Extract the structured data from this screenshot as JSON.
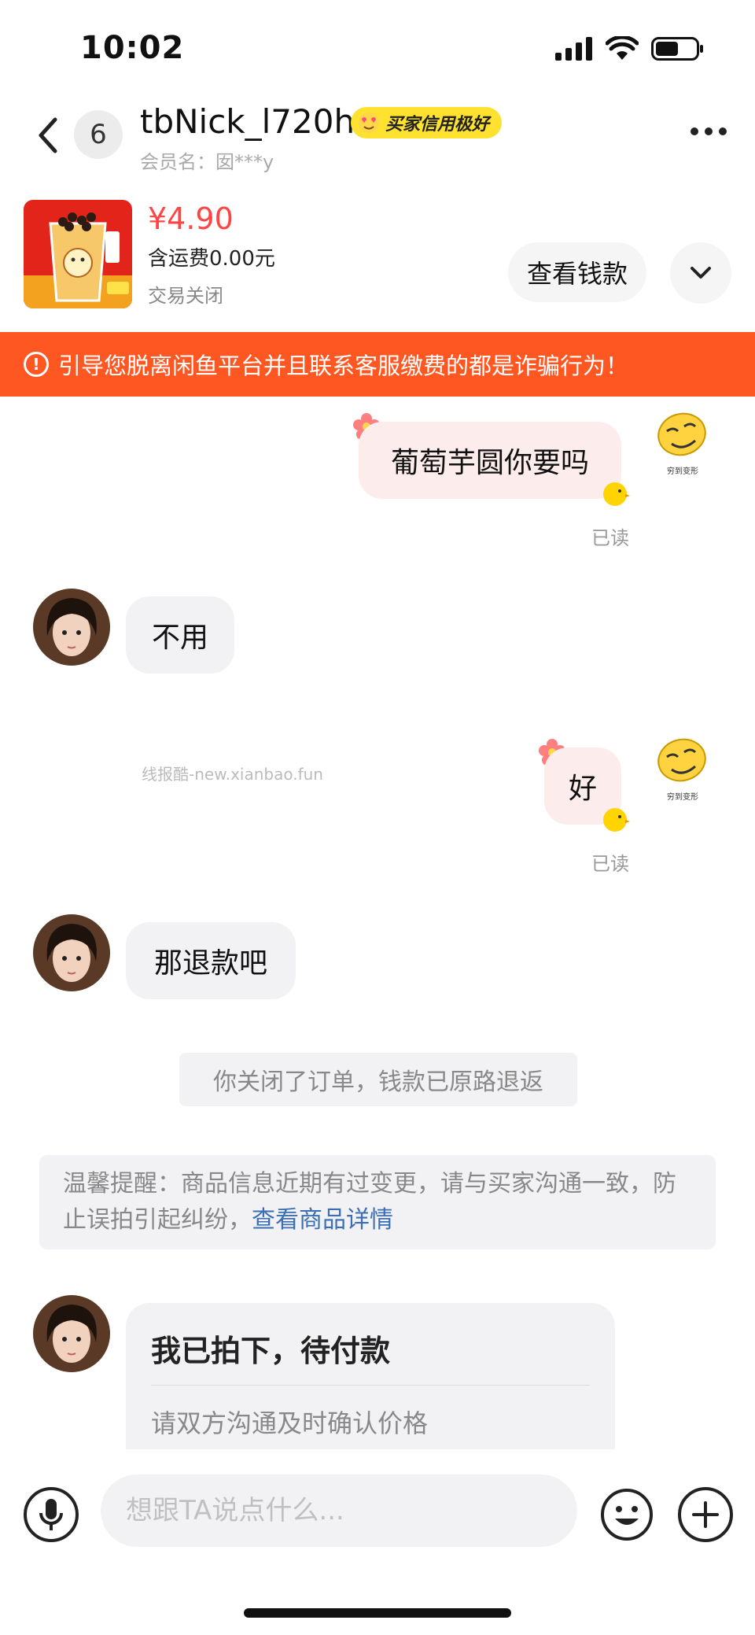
{
  "status_bar": {
    "time": "10:02"
  },
  "header": {
    "unread_count": "6",
    "nickname": "tbNick_l720h",
    "credit_badge": "买家信用极好",
    "member_name": "会员名：囡***y"
  },
  "product": {
    "price": "¥4.90",
    "shipping": "含运费0.00元",
    "status": "交易关闭",
    "check_payment_label": "查看钱款"
  },
  "warning": {
    "text": "引导您脱离闲鱼平台并且联系客服缴费的都是诈骗行为！"
  },
  "messages": [
    {
      "from": "me",
      "text": "葡萄芋圆你要吗",
      "read": "已读",
      "sticker_caption": "穷到变形"
    },
    {
      "from": "other",
      "text": "不用"
    },
    {
      "from": "me",
      "text": "好",
      "read": "已读",
      "sticker_caption": "穷到变形"
    },
    {
      "from": "other",
      "text": "那退款吧"
    }
  ],
  "watermark": "线报酷-new.xianbao.fun",
  "system_notice": "你关闭了订单，钱款已原路退返",
  "tip": {
    "text": "温馨提醒：商品信息近期有过变更，请与买家沟通一致，防止误拍引起纠纷，",
    "link": "查看商品详情"
  },
  "order_card": {
    "title": "我已拍下，待付款",
    "subtitle": "请双方沟通及时确认价格"
  },
  "input_bar": {
    "placeholder": "想跟TA说点什么..."
  },
  "colors": {
    "accent_orange": "#ff5722",
    "price_red": "#ff4444",
    "badge_yellow": "#ffe230",
    "my_bubble": "#fdecec",
    "other_bubble": "#f2f2f4",
    "link_blue": "#3a6fb5"
  },
  "icons": [
    "back-icon",
    "more-icon",
    "chevron-down-icon",
    "warning-icon",
    "microphone-icon",
    "emoji-icon",
    "plus-icon"
  ]
}
